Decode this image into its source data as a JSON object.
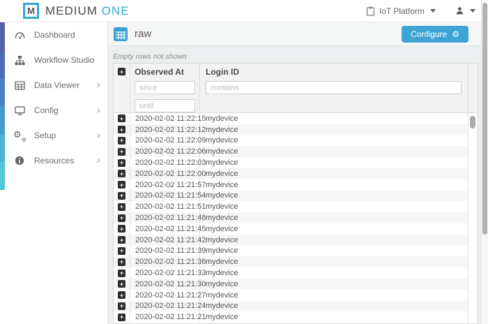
{
  "topbar": {
    "logo_m": "M",
    "logo_medium": "MEDIUM",
    "logo_one": "ONE",
    "platform_label": "IoT Platform"
  },
  "sidebar": {
    "accent_colors": [
      "#5a5fa9",
      "#4c6cb5",
      "#4a7fc1",
      "#459ac9",
      "#49b2d0",
      "#55c6d9"
    ],
    "items": [
      {
        "label": "Dashboard",
        "icon": "dashboard-icon",
        "has_submenu": false
      },
      {
        "label": "Workflow Studio",
        "icon": "sitemap-icon",
        "has_submenu": false
      },
      {
        "label": "Data Viewer",
        "icon": "table-icon",
        "has_submenu": true
      },
      {
        "label": "Config",
        "icon": "desktop-icon",
        "has_submenu": true
      },
      {
        "label": "Setup",
        "icon": "gears-icon",
        "has_submenu": true
      },
      {
        "label": "Resources",
        "icon": "info-icon",
        "has_submenu": true
      }
    ],
    "chevron": "›"
  },
  "content": {
    "title": "raw",
    "configure_label": "Configure",
    "gear_glyph": "⚙",
    "note": "Empty rows not shown",
    "table": {
      "columns": {
        "observed_at": "Observed At",
        "login_id": "Login ID"
      },
      "filters": {
        "since_placeholder": "since",
        "until_placeholder": "until",
        "contains_placeholder": "contains"
      },
      "expand_glyph": "+",
      "rows": [
        {
          "observed_at": "2020-02-02 11:22:15",
          "login_id": "mydevice"
        },
        {
          "observed_at": "2020-02-02 11:22:12",
          "login_id": "mydevice"
        },
        {
          "observed_at": "2020-02-02 11:22:09",
          "login_id": "mydevice"
        },
        {
          "observed_at": "2020-02-02 11:22:06",
          "login_id": "mydevice"
        },
        {
          "observed_at": "2020-02-02 11:22:03",
          "login_id": "mydevice"
        },
        {
          "observed_at": "2020-02-02 11:22:00",
          "login_id": "mydevice"
        },
        {
          "observed_at": "2020-02-02 11:21:57",
          "login_id": "mydevice"
        },
        {
          "observed_at": "2020-02-02 11:21:54",
          "login_id": "mydevice"
        },
        {
          "observed_at": "2020-02-02 11:21:51",
          "login_id": "mydevice"
        },
        {
          "observed_at": "2020-02-02 11:21:48",
          "login_id": "mydevice"
        },
        {
          "observed_at": "2020-02-02 11:21:45",
          "login_id": "mydevice"
        },
        {
          "observed_at": "2020-02-02 11:21:42",
          "login_id": "mydevice"
        },
        {
          "observed_at": "2020-02-02 11:21:39",
          "login_id": "mydevice"
        },
        {
          "observed_at": "2020-02-02 11:21:36",
          "login_id": "mydevice"
        },
        {
          "observed_at": "2020-02-02 11:21:33",
          "login_id": "mydevice"
        },
        {
          "observed_at": "2020-02-02 11:21:30",
          "login_id": "mydevice"
        },
        {
          "observed_at": "2020-02-02 11:21:27",
          "login_id": "mydevice"
        },
        {
          "observed_at": "2020-02-02 11:21:24",
          "login_id": "mydevice"
        },
        {
          "observed_at": "2020-02-02 11:21:21",
          "login_id": "mydevice"
        }
      ]
    }
  },
  "colors": {
    "accent_blue": "#3fa3d4",
    "logo_cyan": "#2fa9d8"
  }
}
